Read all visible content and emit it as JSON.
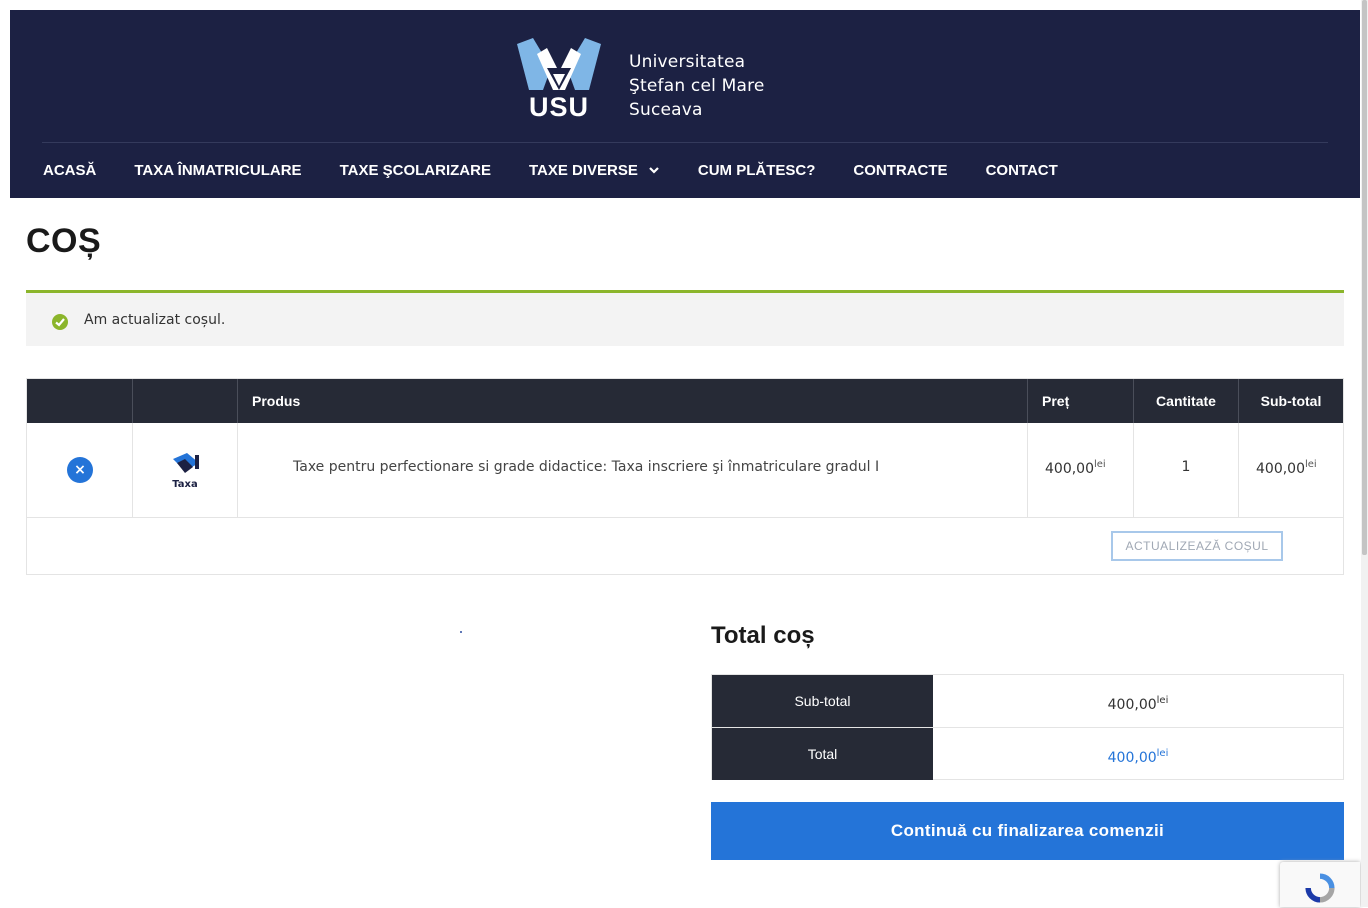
{
  "header": {
    "logo_abbr": "USU",
    "logo_lines": [
      "Universitatea",
      "Ştefan cel Mare",
      "Suceava"
    ],
    "bg_color": "#1c2143"
  },
  "nav": {
    "items": [
      "ACASĂ",
      "TAXA ÎNMATRICULARE",
      "TAXE ŞCOLARIZARE",
      "TAXE DIVERSE",
      "CUM PLĂTESC?",
      "CONTRACTE",
      "CONTACT"
    ],
    "dropdown_item": "TAXE DIVERSE"
  },
  "page": {
    "title": "COȘ"
  },
  "notice": {
    "text": "Am actualizat coșul.",
    "icon": "check-circle-icon",
    "accent": "#8bb52b"
  },
  "cart": {
    "headers": [
      "",
      "",
      "Produs",
      "Preț",
      "Cantitate",
      "Sub-total"
    ],
    "items": [
      {
        "thumb_label": "Taxa",
        "name": "Taxe pentru perfectionare si grade didactice: Taxa inscriere şi înmatriculare gradul I",
        "price": "400,00",
        "currency": "lei",
        "quantity": "1",
        "subtotal": "400,00"
      }
    ],
    "update_label": "ACTUALIZEAZĂ COȘUL"
  },
  "totals": {
    "title": "Total coș",
    "subtotal_label": "Sub-total",
    "subtotal_value": "400,00",
    "total_label": "Total",
    "total_value": "400,00",
    "currency": "lei",
    "total_color": "#2474d8"
  },
  "checkout": {
    "label": "Continuă cu finalizarea comenzii",
    "color": "#2474d8"
  }
}
